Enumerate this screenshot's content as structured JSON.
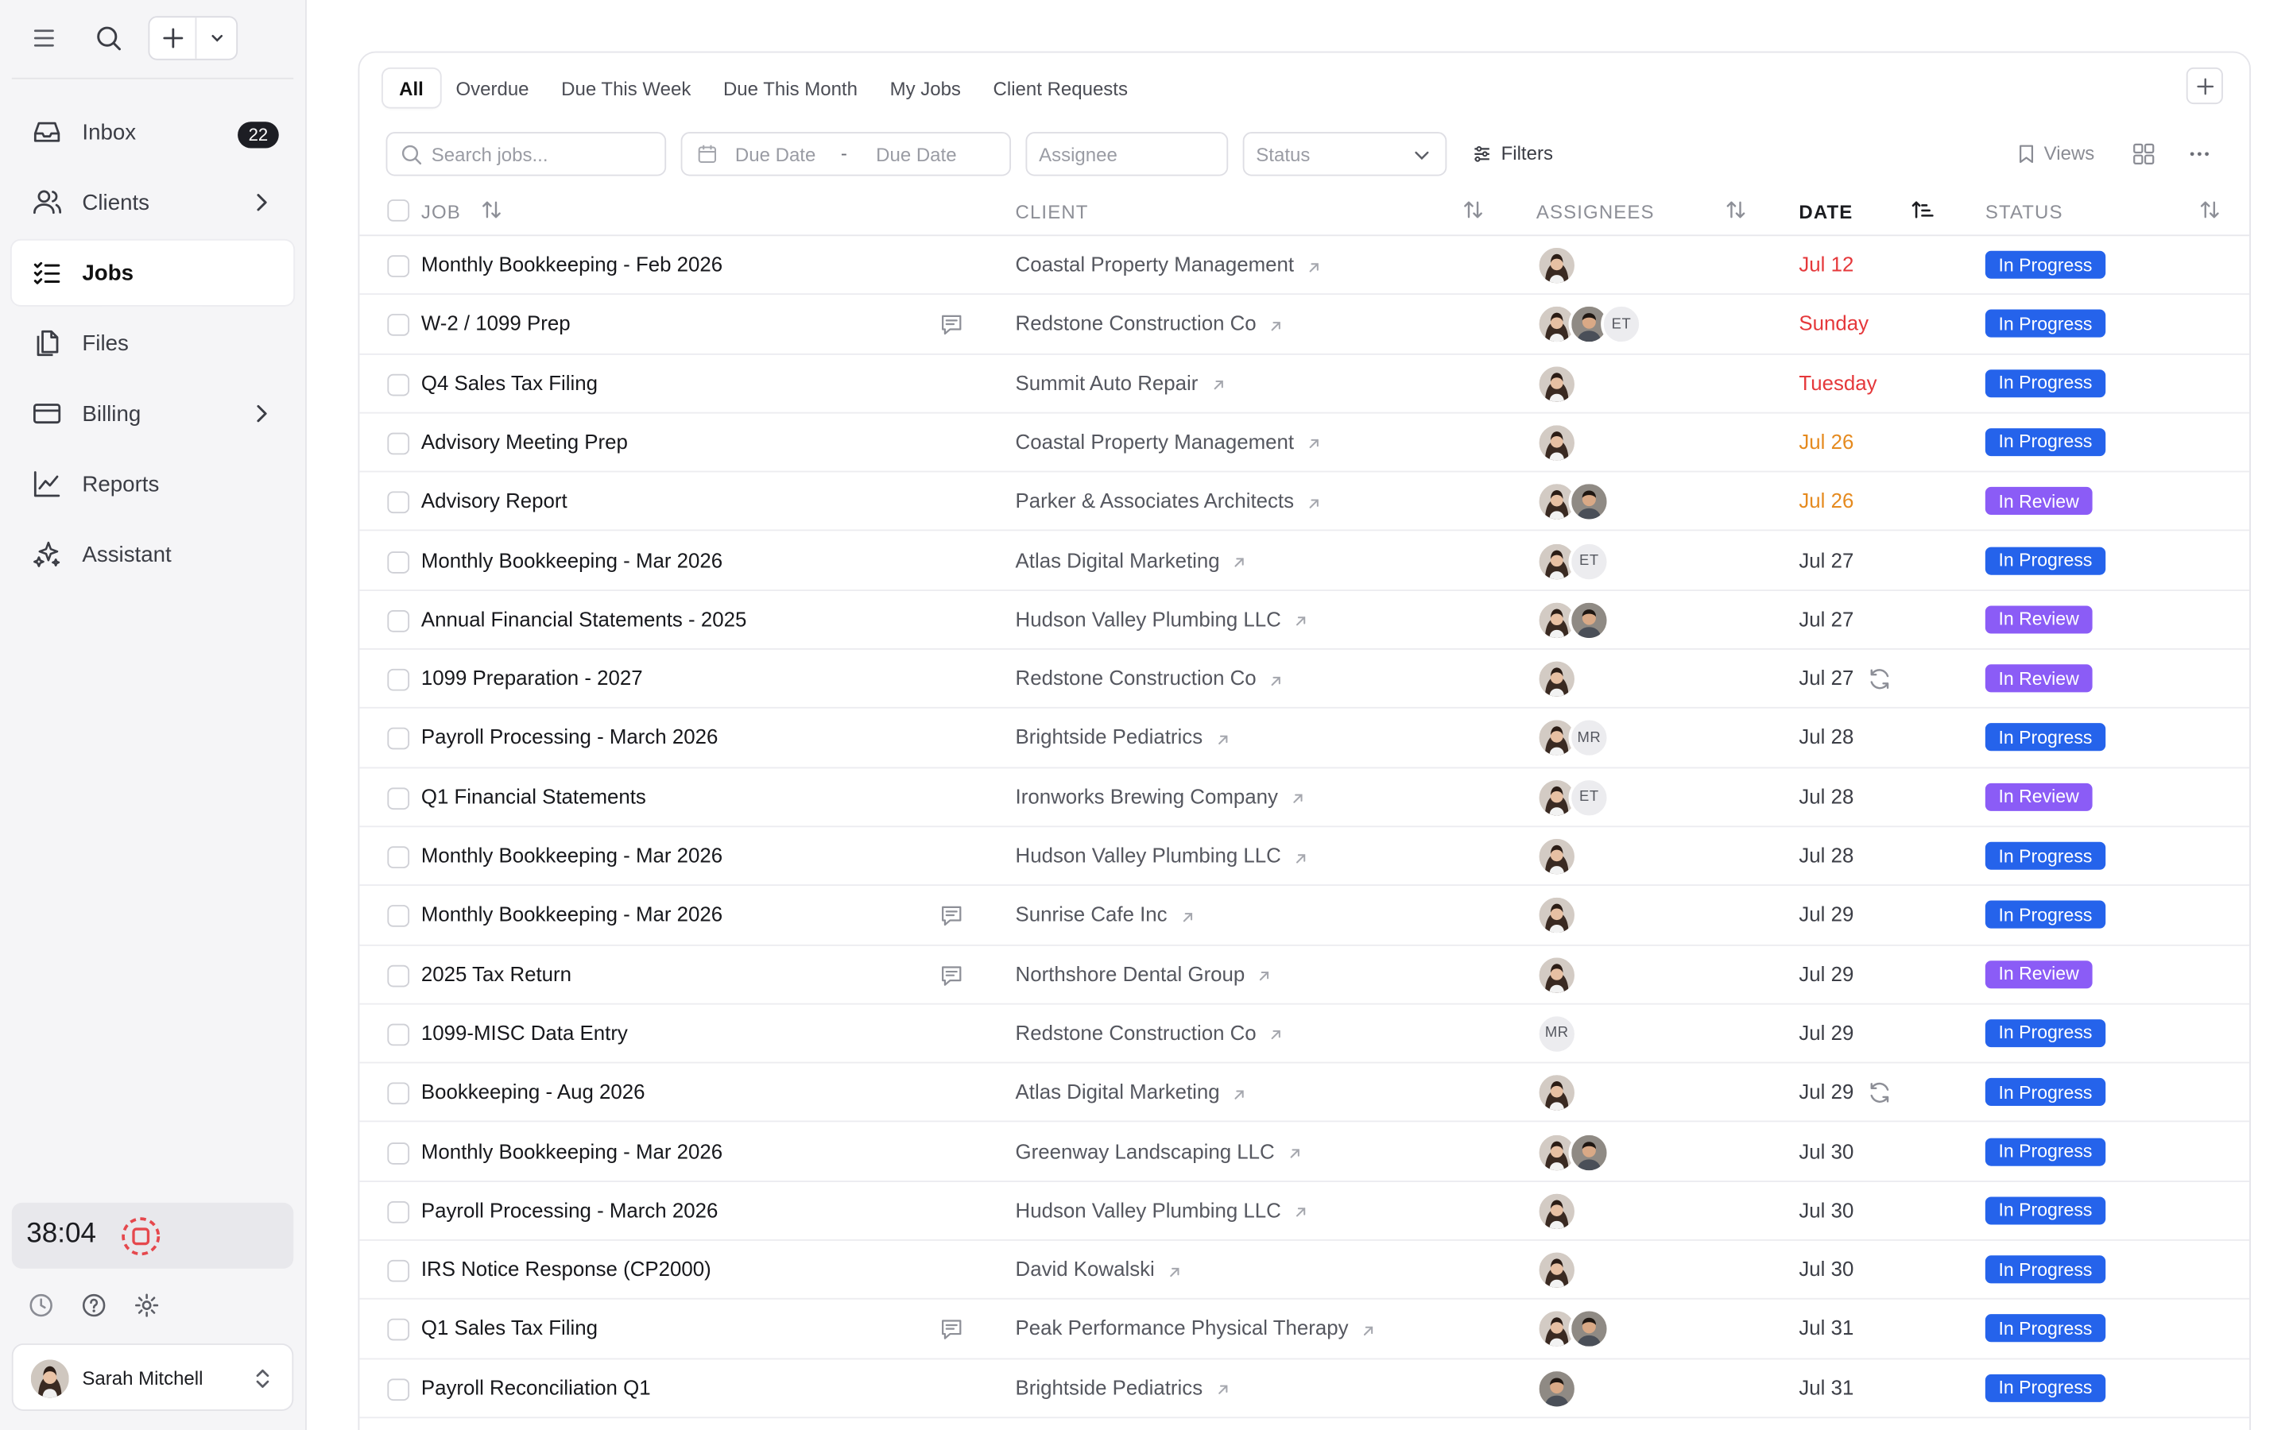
{
  "sidebar": {
    "nav": [
      {
        "label": "Inbox",
        "icon": "inbox-icon",
        "badge": "22"
      },
      {
        "label": "Clients",
        "icon": "clients-icon",
        "arrow": true
      },
      {
        "label": "Jobs",
        "icon": "jobs-icon",
        "active": true
      },
      {
        "label": "Files",
        "icon": "files-icon"
      },
      {
        "label": "Billing",
        "icon": "billing-icon",
        "arrow": true
      },
      {
        "label": "Reports",
        "icon": "reports-icon"
      },
      {
        "label": "Assistant",
        "icon": "assistant-icon"
      }
    ],
    "timer": "38:04",
    "user": {
      "name": "Sarah Mitchell"
    }
  },
  "tabs": [
    "All",
    "Overdue",
    "Due This Week",
    "Due This Month",
    "My Jobs",
    "Client Requests"
  ],
  "active_tab": "All",
  "toolbar": {
    "search_placeholder": "Search jobs...",
    "due_date_from": "Due Date",
    "due_date_sep": "-",
    "due_date_to": "Due Date",
    "assignee_placeholder": "Assignee",
    "status_placeholder": "Status",
    "filters_label": "Filters",
    "views_label": "Views"
  },
  "columns": {
    "job": "JOB",
    "client": "CLIENT",
    "assignees": "ASSIGNEES",
    "date": "DATE",
    "status": "STATUS"
  },
  "colors": {
    "in_progress": "#2563eb",
    "in_review": "#8b5cf6",
    "date_red": "#e5383b",
    "date_orange": "#e58a1f",
    "date_normal": "#3b3d45"
  },
  "rows": [
    {
      "job": "Monthly Bookkeeping - Feb 2026",
      "client": "Coastal Property Management",
      "assignees": [
        "woman"
      ],
      "date": "Jul 12",
      "date_tone": "red",
      "status": "In Progress",
      "note": false,
      "repeat": false
    },
    {
      "job": "W-2 / 1099 Prep",
      "client": "Redstone Construction Co",
      "assignees": [
        "woman",
        "man",
        "ET"
      ],
      "date": "Sunday",
      "date_tone": "red",
      "status": "In Progress",
      "note": true,
      "repeat": false
    },
    {
      "job": "Q4 Sales Tax Filing",
      "client": "Summit Auto Repair",
      "assignees": [
        "woman"
      ],
      "date": "Tuesday",
      "date_tone": "red",
      "status": "In Progress",
      "note": false,
      "repeat": false
    },
    {
      "job": "Advisory Meeting Prep",
      "client": "Coastal Property Management",
      "assignees": [
        "woman"
      ],
      "date": "Jul 26",
      "date_tone": "orange",
      "status": "In Progress",
      "note": false,
      "repeat": false
    },
    {
      "job": "Advisory Report",
      "client": "Parker & Associates Architects",
      "assignees": [
        "woman",
        "man"
      ],
      "date": "Jul 26",
      "date_tone": "orange",
      "status": "In Review",
      "note": false,
      "repeat": false
    },
    {
      "job": "Monthly Bookkeeping - Mar 2026",
      "client": "Atlas Digital Marketing",
      "assignees": [
        "woman",
        "ET"
      ],
      "date": "Jul 27",
      "date_tone": "normal",
      "status": "In Progress",
      "note": false,
      "repeat": false
    },
    {
      "job": "Annual Financial Statements - 2025",
      "client": "Hudson Valley Plumbing LLC",
      "assignees": [
        "woman",
        "man"
      ],
      "date": "Jul 27",
      "date_tone": "normal",
      "status": "In Review",
      "note": false,
      "repeat": false
    },
    {
      "job": "1099 Preparation - 2027",
      "client": "Redstone Construction Co",
      "assignees": [
        "woman"
      ],
      "date": "Jul 27",
      "date_tone": "normal",
      "status": "In Review",
      "note": false,
      "repeat": true
    },
    {
      "job": "Payroll Processing - March 2026",
      "client": "Brightside Pediatrics",
      "assignees": [
        "woman",
        "MR"
      ],
      "date": "Jul 28",
      "date_tone": "normal",
      "status": "In Progress",
      "note": false,
      "repeat": false
    },
    {
      "job": "Q1 Financial Statements",
      "client": "Ironworks Brewing Company",
      "assignees": [
        "woman",
        "ET"
      ],
      "date": "Jul 28",
      "date_tone": "normal",
      "status": "In Review",
      "note": false,
      "repeat": false
    },
    {
      "job": "Monthly Bookkeeping - Mar 2026",
      "client": "Hudson Valley Plumbing LLC",
      "assignees": [
        "woman"
      ],
      "date": "Jul 28",
      "date_tone": "normal",
      "status": "In Progress",
      "note": false,
      "repeat": false
    },
    {
      "job": "Monthly Bookkeeping - Mar 2026",
      "client": "Sunrise Cafe Inc",
      "assignees": [
        "woman"
      ],
      "date": "Jul 29",
      "date_tone": "normal",
      "status": "In Progress",
      "note": true,
      "repeat": false
    },
    {
      "job": "2025 Tax Return",
      "client": "Northshore Dental Group",
      "assignees": [
        "woman"
      ],
      "date": "Jul 29",
      "date_tone": "normal",
      "status": "In Review",
      "note": true,
      "repeat": false
    },
    {
      "job": "1099-MISC Data Entry",
      "client": "Redstone Construction Co",
      "assignees": [
        "MR"
      ],
      "date": "Jul 29",
      "date_tone": "normal",
      "status": "In Progress",
      "note": false,
      "repeat": false
    },
    {
      "job": "Bookkeeping - Aug 2026",
      "client": "Atlas Digital Marketing",
      "assignees": [
        "woman"
      ],
      "date": "Jul 29",
      "date_tone": "normal",
      "status": "In Progress",
      "note": false,
      "repeat": true
    },
    {
      "job": "Monthly Bookkeeping - Mar 2026",
      "client": "Greenway Landscaping LLC",
      "assignees": [
        "woman",
        "man"
      ],
      "date": "Jul 30",
      "date_tone": "normal",
      "status": "In Progress",
      "note": false,
      "repeat": false
    },
    {
      "job": "Payroll Processing - March 2026",
      "client": "Hudson Valley Plumbing LLC",
      "assignees": [
        "woman"
      ],
      "date": "Jul 30",
      "date_tone": "normal",
      "status": "In Progress",
      "note": false,
      "repeat": false
    },
    {
      "job": "IRS Notice Response (CP2000)",
      "client": "David Kowalski",
      "assignees": [
        "woman"
      ],
      "date": "Jul 30",
      "date_tone": "normal",
      "status": "In Progress",
      "note": false,
      "repeat": false
    },
    {
      "job": "Q1 Sales Tax Filing",
      "client": "Peak Performance Physical Therapy",
      "assignees": [
        "woman",
        "man"
      ],
      "date": "Jul 31",
      "date_tone": "normal",
      "status": "In Progress",
      "note": true,
      "repeat": false
    },
    {
      "job": "Payroll Reconciliation Q1",
      "client": "Brightside Pediatrics",
      "assignees": [
        "man"
      ],
      "date": "Jul 31",
      "date_tone": "normal",
      "status": "In Progress",
      "note": false,
      "repeat": false
    }
  ]
}
